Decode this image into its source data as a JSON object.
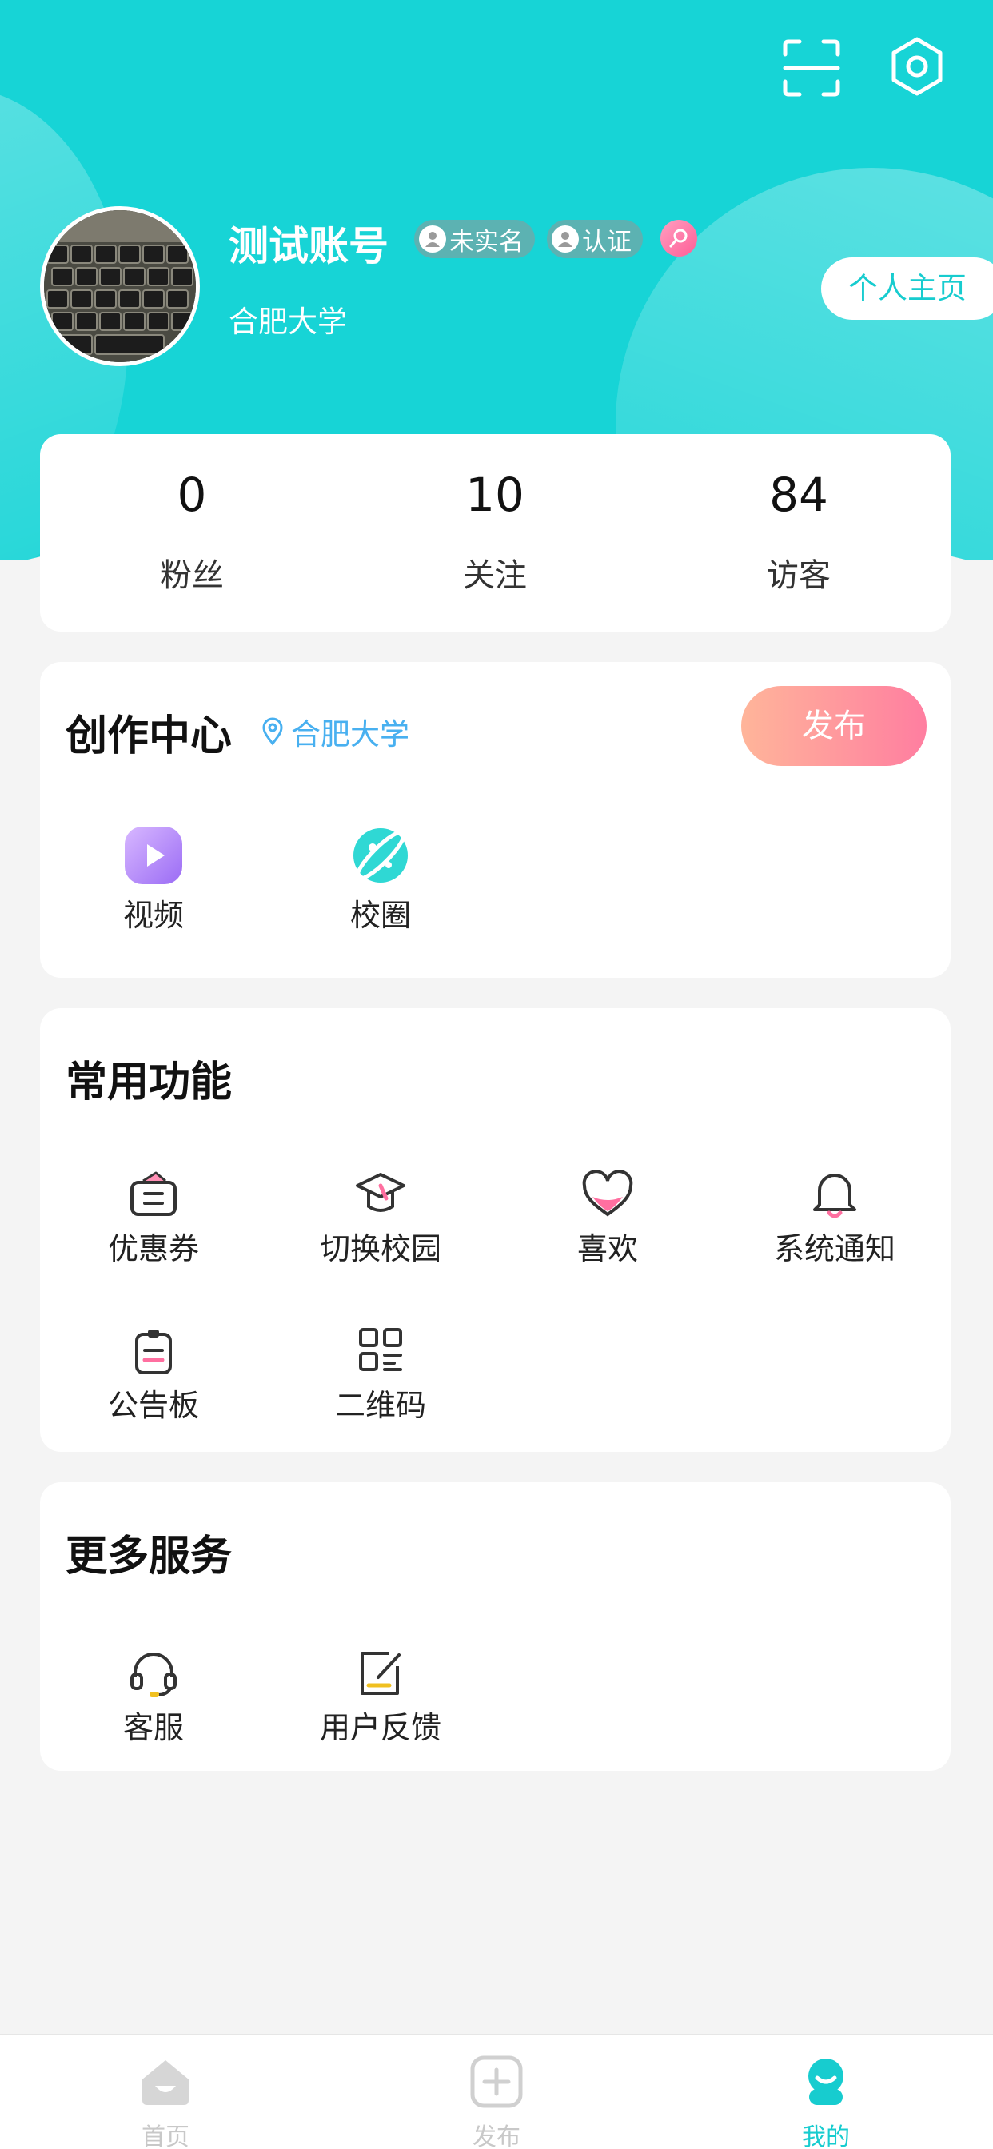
{
  "header": {
    "username": "测试账号",
    "badges": {
      "unverified": "未实名",
      "certified": "认证"
    },
    "school": "合肥大学",
    "profile_button": "个人主页",
    "icons": [
      "scan-icon",
      "settings-icon"
    ]
  },
  "stats": [
    {
      "value": "0",
      "label": "粉丝"
    },
    {
      "value": "10",
      "label": "关注"
    },
    {
      "value": "84",
      "label": "访客"
    }
  ],
  "creation": {
    "title": "创作中心",
    "location": "合肥大学",
    "publish_button": "发布",
    "items": [
      {
        "label": "视频",
        "icon": "video-icon"
      },
      {
        "label": "校圈",
        "icon": "campus-circle-icon"
      }
    ]
  },
  "functions": {
    "title": "常用功能",
    "items": [
      {
        "label": "优惠券",
        "icon": "coupon-icon"
      },
      {
        "label": "切换校园",
        "icon": "switch-campus-icon"
      },
      {
        "label": "喜欢",
        "icon": "heart-icon"
      },
      {
        "label": "系统通知",
        "icon": "bell-icon"
      },
      {
        "label": "公告板",
        "icon": "bulletin-icon"
      },
      {
        "label": "二维码",
        "icon": "qrcode-icon"
      }
    ]
  },
  "services": {
    "title": "更多服务",
    "items": [
      {
        "label": "客服",
        "icon": "headset-icon"
      },
      {
        "label": "用户反馈",
        "icon": "feedback-icon"
      }
    ]
  },
  "tabbar": {
    "items": [
      {
        "label": "首页",
        "icon": "home-icon"
      },
      {
        "label": "发布",
        "icon": "plus-icon"
      },
      {
        "label": "我的",
        "icon": "profile-icon"
      }
    ],
    "active_index": 2
  },
  "colors": {
    "brand": "#17d4d6",
    "publish_gradient": [
      "#ffb59a",
      "#ff7ea0"
    ],
    "location": "#48b0f0",
    "accent_pink": "#ff6fa0"
  }
}
